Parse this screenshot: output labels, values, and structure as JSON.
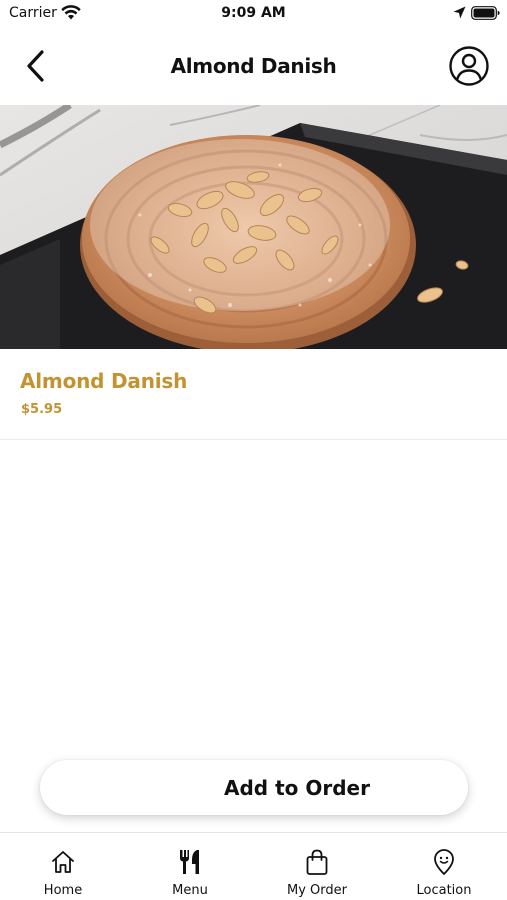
{
  "status_bar": {
    "carrier": "Carrier",
    "time": "9:09 AM",
    "icons": [
      "wifi-icon",
      "location-arrow-icon",
      "battery-icon"
    ]
  },
  "nav": {
    "title": "Almond Danish",
    "back_icon": "chevron-left-icon",
    "profile_icon": "user-circle-icon"
  },
  "hero": {
    "image": "almond-danish-photo"
  },
  "product": {
    "name": "Almond Danish",
    "price": "$5.95"
  },
  "actions": {
    "add_to_order": "Add to Order"
  },
  "tabs": [
    {
      "label": "Home",
      "icon": "home-icon"
    },
    {
      "label": "Menu",
      "icon": "fork-knife-icon"
    },
    {
      "label": "My Order",
      "icon": "shopping-bag-icon"
    },
    {
      "label": "Location",
      "icon": "map-pin-icon"
    }
  ],
  "colors": {
    "accent": "#c39332",
    "text": "#111111",
    "background": "#ffffff"
  }
}
